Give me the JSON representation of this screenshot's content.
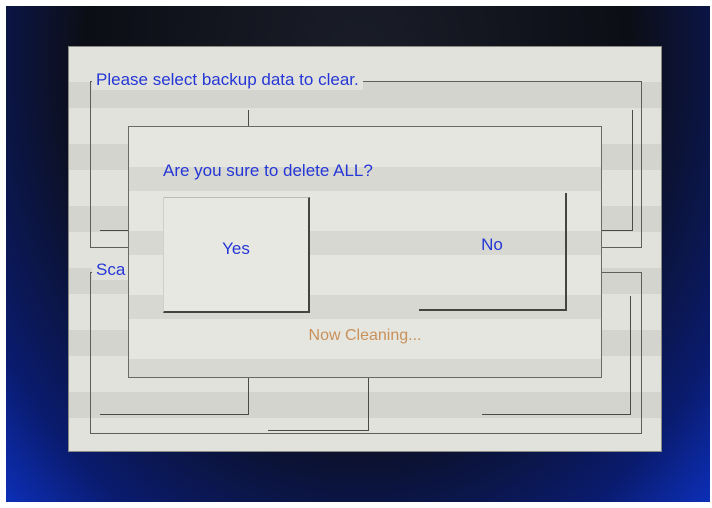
{
  "backup_group": {
    "title": "Please select backup data to clear."
  },
  "scan_group": {
    "title": "Sca"
  },
  "dialog": {
    "question": "Are you sure to delete ALL?",
    "yes_label": "Yes",
    "no_label": "No",
    "status": "Now Cleaning..."
  },
  "colors": {
    "text_blue": "#2436d6",
    "status_orange": "#c8915a",
    "panel_gray": "#e2e2dc"
  }
}
